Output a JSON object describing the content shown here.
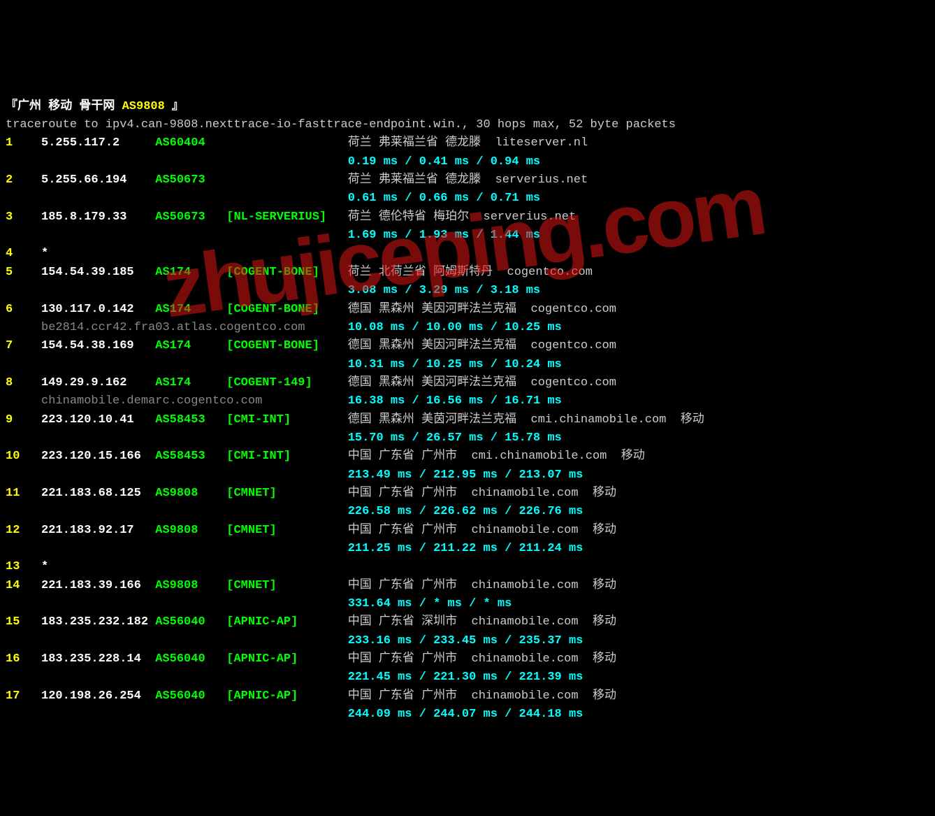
{
  "header": {
    "prefix": "『广州 移动 骨干网",
    "asn": " AS9808 ",
    "suffix": "』"
  },
  "cmd": "traceroute to ipv4.can-9808.nexttrace-io-fasttrace-endpoint.win., 30 hops max, 52 byte packets",
  "hops": [
    {
      "n": "1",
      "ip": "5.255.117.2",
      "asn": "AS60404",
      "tag": "",
      "loc": "荷兰 弗莱福兰省 德龙滕  liteserver.nl",
      "lat": "0.19 ms / 0.41 ms / 0.94 ms"
    },
    {
      "n": "2",
      "ip": "5.255.66.194",
      "asn": "AS50673",
      "tag": "",
      "loc": "荷兰 弗莱福兰省 德龙滕  serverius.net",
      "lat": "0.61 ms / 0.66 ms / 0.71 ms"
    },
    {
      "n": "3",
      "ip": "185.8.179.33",
      "asn": "AS50673",
      "tag": "[NL-SERVERIUS]",
      "loc": "荷兰 德伦特省 梅珀尔  serverius.net",
      "lat": "1.69 ms / 1.93 ms / 1.44 ms"
    },
    {
      "n": "4",
      "ip": "*",
      "asn": "",
      "tag": "",
      "loc": "",
      "lat": ""
    },
    {
      "n": "5",
      "ip": "154.54.39.185",
      "asn": "AS174",
      "tag": "[COGENT-BONE]",
      "loc": "荷兰 北荷兰省 阿姆斯特丹  cogentco.com",
      "lat": "3.08 ms / 3.29 ms / 3.18 ms"
    },
    {
      "n": "6",
      "ip": "130.117.0.142",
      "asn": "AS174",
      "tag": "[COGENT-BONE]",
      "loc": "德国 黑森州 美因河畔法兰克福  cogentco.com",
      "lat": "10.08 ms / 10.00 ms / 10.25 ms",
      "rdns": "be2814.ccr42.fra03.atlas.cogentco.com"
    },
    {
      "n": "7",
      "ip": "154.54.38.169",
      "asn": "AS174",
      "tag": "[COGENT-BONE]",
      "loc": "德国 黑森州 美因河畔法兰克福  cogentco.com",
      "lat": "10.31 ms / 10.25 ms / 10.24 ms"
    },
    {
      "n": "8",
      "ip": "149.29.9.162",
      "asn": "AS174",
      "tag": "[COGENT-149]",
      "loc": "德国 黑森州 美因河畔法兰克福  cogentco.com",
      "lat": "16.38 ms / 16.56 ms / 16.71 ms",
      "rdns": "chinamobile.demarc.cogentco.com"
    },
    {
      "n": "9",
      "ip": "223.120.10.41",
      "asn": "AS58453",
      "tag": "[CMI-INT]",
      "loc": "德国 黑森州 美茵河畔法兰克福  cmi.chinamobile.com  移动",
      "lat": "15.70 ms / 26.57 ms / 15.78 ms"
    },
    {
      "n": "10",
      "ip": "223.120.15.166",
      "asn": "AS58453",
      "tag": "[CMI-INT]",
      "loc": "中国 广东省 广州市  cmi.chinamobile.com  移动",
      "lat": "213.49 ms / 212.95 ms / 213.07 ms"
    },
    {
      "n": "11",
      "ip": "221.183.68.125",
      "asn": "AS9808",
      "tag": "[CMNET]",
      "loc": "中国 广东省 广州市  chinamobile.com  移动",
      "lat": "226.58 ms / 226.62 ms / 226.76 ms"
    },
    {
      "n": "12",
      "ip": "221.183.92.17",
      "asn": "AS9808",
      "tag": "[CMNET]",
      "loc": "中国 广东省 广州市  chinamobile.com  移动",
      "lat": "211.25 ms / 211.22 ms / 211.24 ms"
    },
    {
      "n": "13",
      "ip": "*",
      "asn": "",
      "tag": "",
      "loc": "",
      "lat": ""
    },
    {
      "n": "14",
      "ip": "221.183.39.166",
      "asn": "AS9808",
      "tag": "[CMNET]",
      "loc": "中国 广东省 广州市  chinamobile.com  移动",
      "lat": "331.64 ms / * ms / * ms"
    },
    {
      "n": "15",
      "ip": "183.235.232.182",
      "asn": "AS56040",
      "tag": "[APNIC-AP]",
      "loc": "中国 广东省 深圳市  chinamobile.com  移动",
      "lat": "233.16 ms / 233.45 ms / 235.37 ms"
    },
    {
      "n": "16",
      "ip": "183.235.228.14",
      "asn": "AS56040",
      "tag": "[APNIC-AP]",
      "loc": "中国 广东省 广州市  chinamobile.com  移动",
      "lat": "221.45 ms / 221.30 ms / 221.39 ms"
    },
    {
      "n": "17",
      "ip": "120.198.26.254",
      "asn": "AS56040",
      "tag": "[APNIC-AP]",
      "loc": "中国 广东省 广州市  chinamobile.com  移动",
      "lat": "244.09 ms / 244.07 ms / 244.18 ms"
    }
  ],
  "watermark": "zhujiceping.com"
}
